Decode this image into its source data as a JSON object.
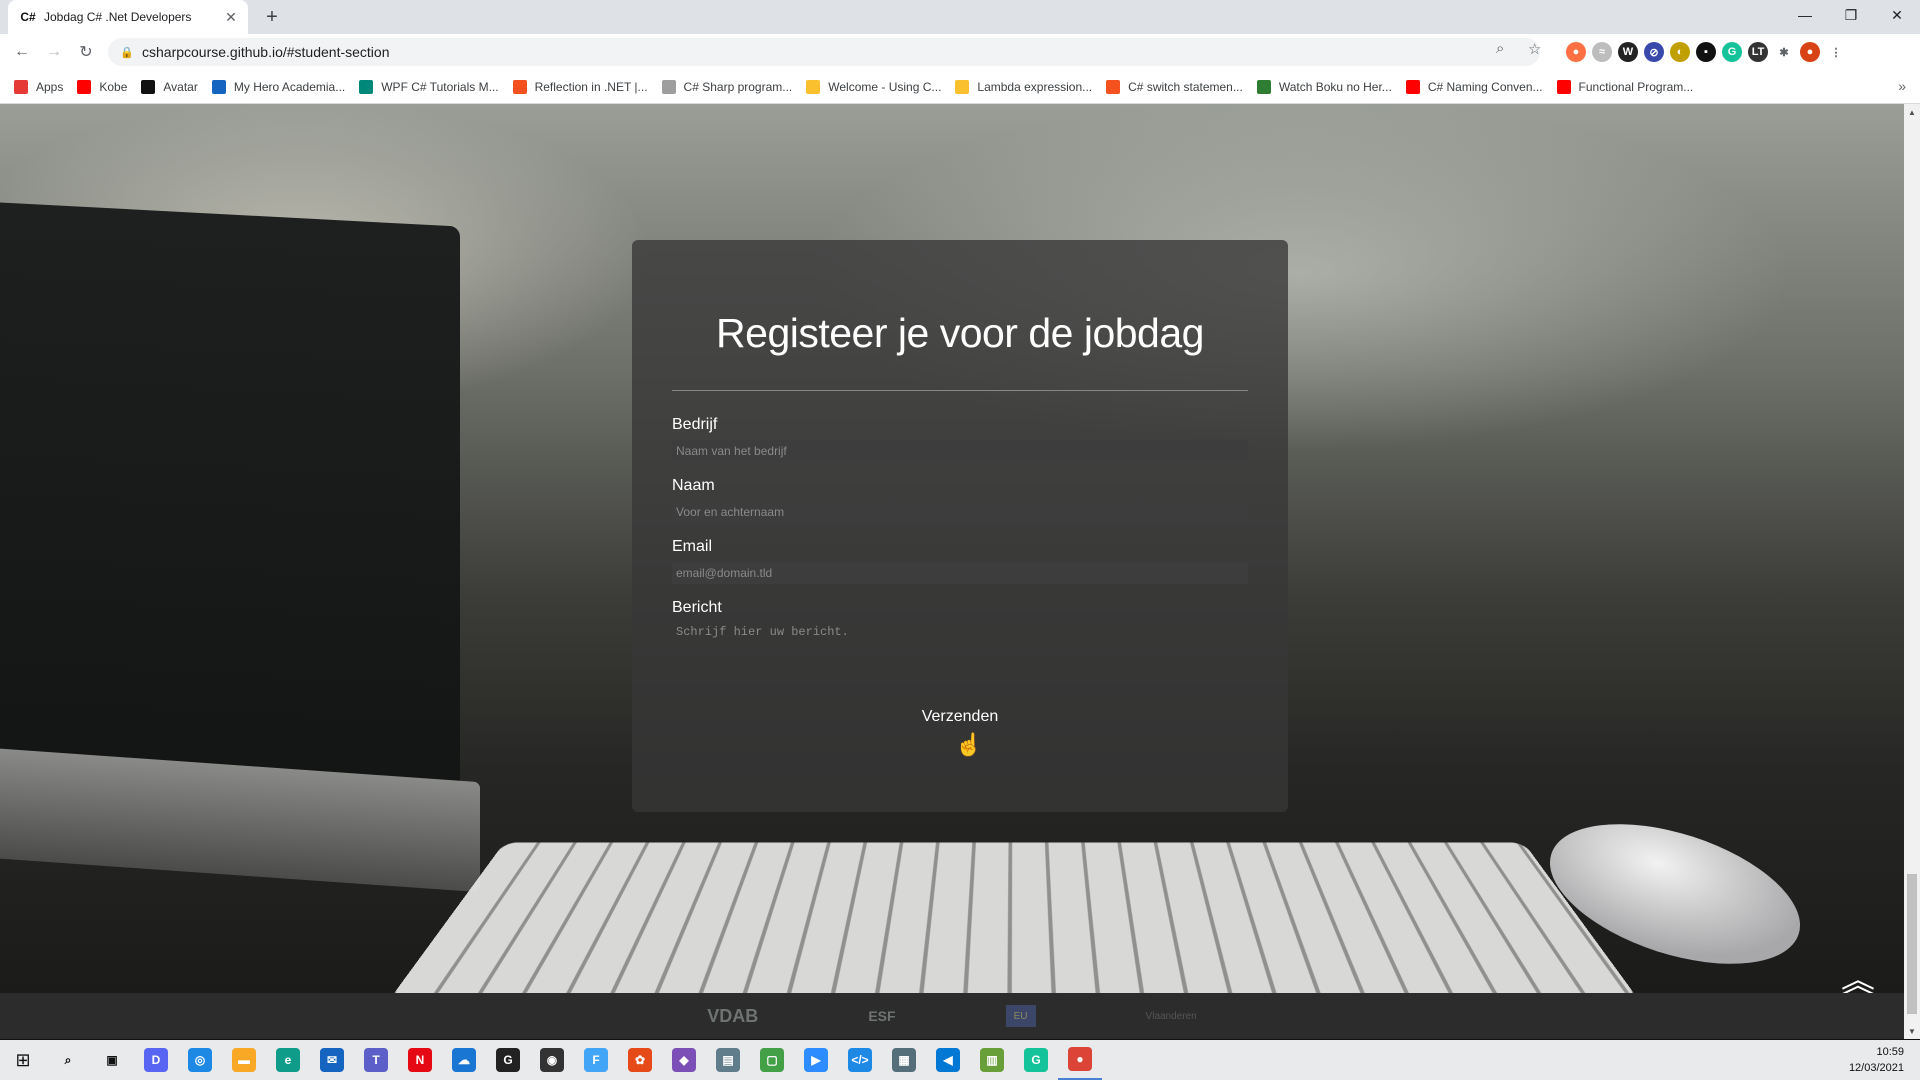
{
  "browser": {
    "tab_favicon": "C#",
    "tab_title": "Jobdag C# .Net Developers",
    "tab_close": "✕",
    "new_tab": "+",
    "url": "csharpcourse.github.io/#student-section",
    "minimize": "—",
    "maximize": "❐",
    "close": "✕"
  },
  "bookmarks": [
    {
      "label": "Apps",
      "color": "#e53935"
    },
    {
      "label": "Kobe",
      "color": "#ff0000"
    },
    {
      "label": "Avatar",
      "color": "#111111"
    },
    {
      "label": "My Hero Academia...",
      "color": "#1565c0"
    },
    {
      "label": "WPF C# Tutorials M...",
      "color": "#00897b"
    },
    {
      "label": "Reflection in .NET |...",
      "color": "#f4511e"
    },
    {
      "label": "C# Sharp program...",
      "color": "#9e9e9e"
    },
    {
      "label": "Welcome - Using C...",
      "color": "#fbc02d"
    },
    {
      "label": "Lambda expression...",
      "color": "#fbc02d"
    },
    {
      "label": "C# switch statemen...",
      "color": "#f4511e"
    },
    {
      "label": "Watch Boku no Her...",
      "color": "#2e7d32"
    },
    {
      "label": "C# Naming Conven...",
      "color": "#ff0000"
    },
    {
      "label": "Functional Program...",
      "color": "#ff0000"
    }
  ],
  "form": {
    "title": "Registeer je voor de jobdag",
    "company_label": "Bedrijf",
    "company_placeholder": "Naam van het bedrijf",
    "name_label": "Naam",
    "name_placeholder": "Voor en achternaam",
    "email_label": "Email",
    "email_placeholder": "email@domain.tld",
    "message_label": "Bericht",
    "message_placeholder": "Schrijf hier uw bericht.",
    "submit_label": "Verzenden"
  },
  "footer": {
    "logos": [
      "VDAB",
      "ESF",
      "EU",
      "Vlaanderen"
    ]
  },
  "taskbar": {
    "clock_time": "10:59",
    "clock_date": "12/03/2021",
    "apps": [
      {
        "name": "search-icon",
        "glyph": "⌕",
        "color": "#e9eaec"
      },
      {
        "name": "task-view-icon",
        "glyph": "▣",
        "color": "#e9eaec"
      },
      {
        "name": "discord-icon",
        "glyph": "D",
        "color": "#5865f2"
      },
      {
        "name": "app-icon",
        "glyph": "◎",
        "color": "#1e88e5"
      },
      {
        "name": "file-explorer-icon",
        "glyph": "▬",
        "color": "#f9a825"
      },
      {
        "name": "edge-icon",
        "glyph": "e",
        "color": "#0f9d8a"
      },
      {
        "name": "mail-icon",
        "glyph": "✉",
        "color": "#1565c0"
      },
      {
        "name": "teams-icon",
        "glyph": "T",
        "color": "#5b5fc7"
      },
      {
        "name": "netflix-icon",
        "glyph": "N",
        "color": "#e50914"
      },
      {
        "name": "onedrive-icon",
        "glyph": "☁",
        "color": "#1976d2"
      },
      {
        "name": "app-g-icon",
        "glyph": "G",
        "color": "#222222"
      },
      {
        "name": "app-shield-icon",
        "glyph": "◉",
        "color": "#333333"
      },
      {
        "name": "app-f-icon",
        "glyph": "F",
        "color": "#42a5f5"
      },
      {
        "name": "app-red-icon",
        "glyph": "✿",
        "color": "#e64a19"
      },
      {
        "name": "visual-studio-icon",
        "glyph": "◆",
        "color": "#7b4fb5"
      },
      {
        "name": "app-printer-icon",
        "glyph": "▤",
        "color": "#607d8b"
      },
      {
        "name": "app-green-icon",
        "glyph": "▢",
        "color": "#43a047"
      },
      {
        "name": "zoom-icon",
        "glyph": "▶",
        "color": "#2d8cff"
      },
      {
        "name": "app-code-icon",
        "glyph": "</>",
        "color": "#1e88e5"
      },
      {
        "name": "app-window-icon",
        "glyph": "▦",
        "color": "#546e7a"
      },
      {
        "name": "vscode-icon",
        "glyph": "◀",
        "color": "#0078d4"
      },
      {
        "name": "app-chart-icon",
        "glyph": "▥",
        "color": "#689f38"
      },
      {
        "name": "grammarly-icon",
        "glyph": "G",
        "color": "#15c39a"
      },
      {
        "name": "chrome-icon",
        "glyph": "●",
        "color": "#db4437"
      }
    ]
  }
}
